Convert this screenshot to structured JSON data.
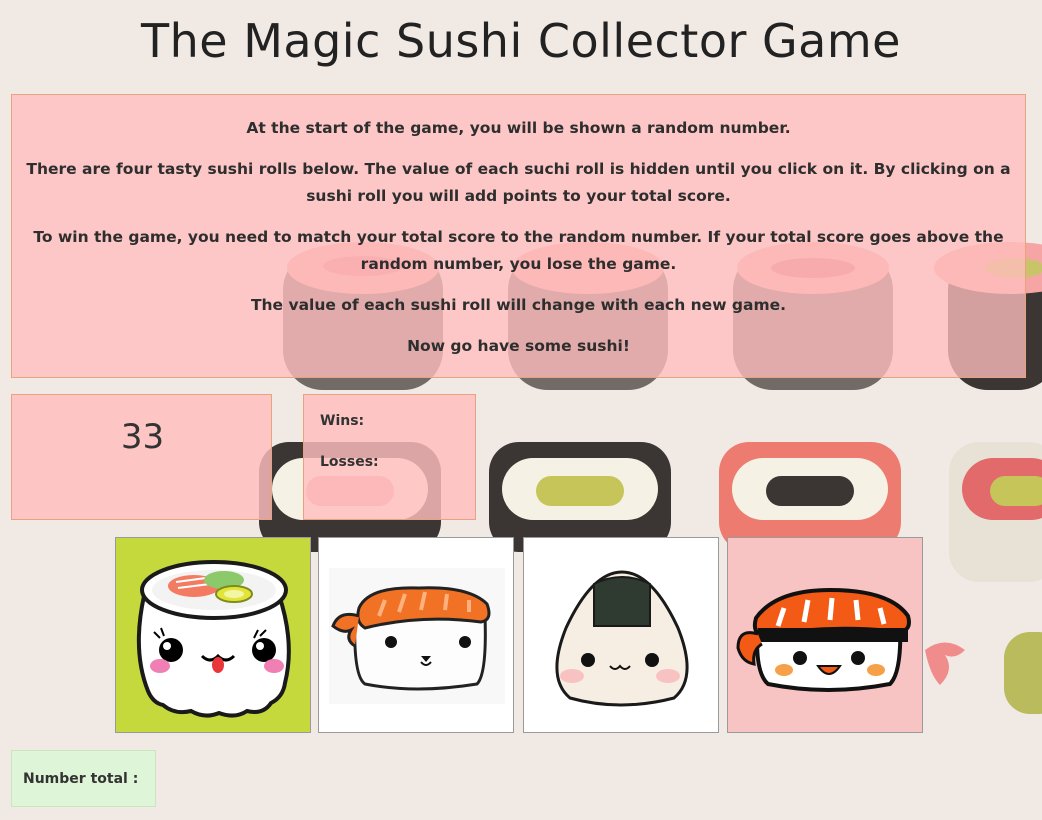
{
  "title": "The Magic Sushi Collector Game",
  "instructions": [
    "At the start of the game, you will be shown a random number.",
    "There are four tasty sushi rolls below. The value of each suchi roll is hidden until you click on it. By clicking on a sushi roll you will add points to your total score.",
    "To win the game, you need to match your total score to the random number. If your total score goes above the random number, you lose the game.",
    "The value of each sushi roll will change with each new game.",
    "Now go have some sushi!"
  ],
  "random_number": "33",
  "score": {
    "wins_label": "Wins:",
    "losses_label": "Losses:"
  },
  "sushi": [
    {
      "name": "maki-roll-sushi",
      "bg": "#c5d83c"
    },
    {
      "name": "salmon-nigiri-sushi",
      "bg": "#ffffff"
    },
    {
      "name": "onigiri-sushi",
      "bg": "#ffffff"
    },
    {
      "name": "salmon-headband-sushi",
      "bg": "#f7c3c3"
    }
  ],
  "total": {
    "label": "Number total :"
  },
  "colors": {
    "panel": "#ffbebe",
    "panel_border": "#e9a27e",
    "total_bg": "#dff5d8",
    "page_bg": "#f1e9e4"
  }
}
